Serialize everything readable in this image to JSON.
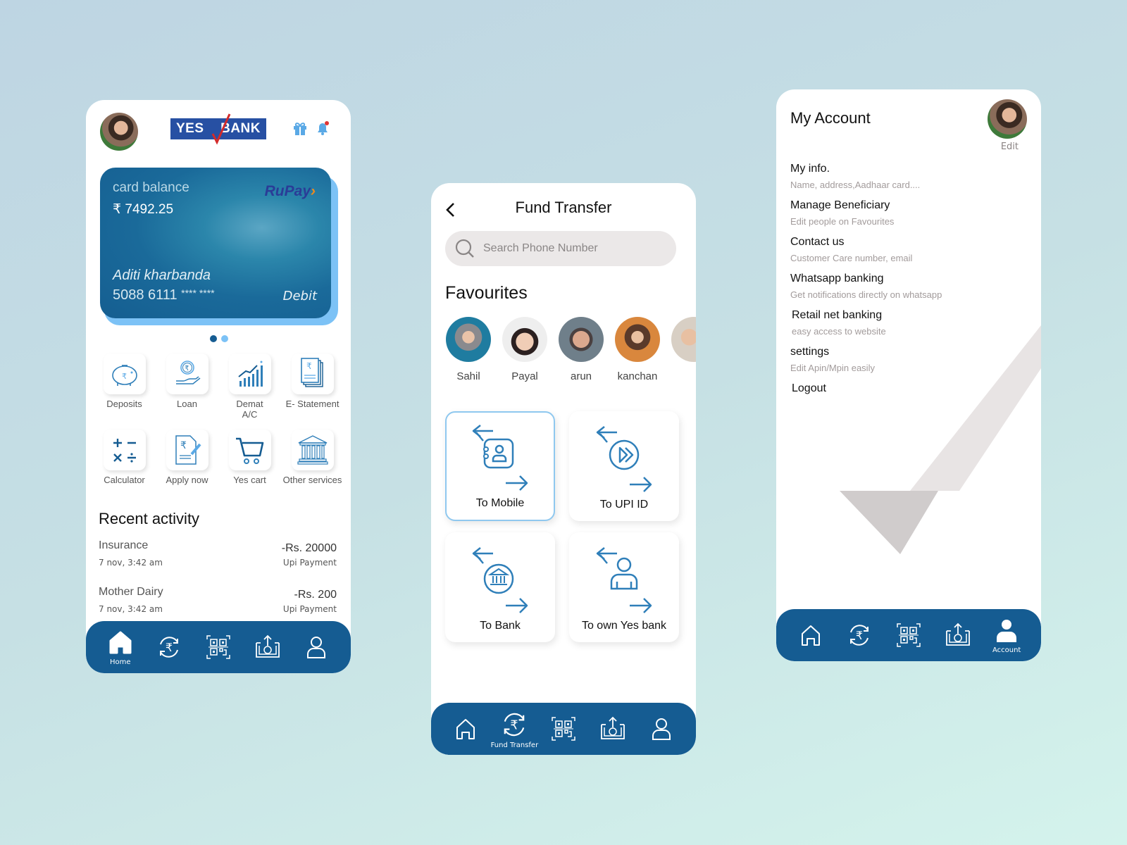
{
  "colors": {
    "brand_blue": "#155c92",
    "accent_light": "#7cc2f6",
    "icon_blue": "#2f7fb9",
    "logo_blue": "#2750a3"
  },
  "home": {
    "logo": {
      "left": "YES",
      "right": "BANK"
    },
    "card": {
      "balance_label": "card balance",
      "currency": "₹",
      "balance": "7492.25",
      "network": "RuPay",
      "holder": "Aditi kharbanda",
      "number_visible": "5088 6111",
      "number_masked": "**** ****",
      "type": "Debit"
    },
    "carousel": {
      "pages": 2,
      "active": 1
    },
    "services": [
      {
        "label": "Deposits",
        "icon": "piggy-bank-icon"
      },
      {
        "label": "Loan",
        "icon": "loan-icon"
      },
      {
        "label": "Demat A/C",
        "icon": "growth-chart-icon"
      },
      {
        "label": "E- Statement",
        "icon": "statement-icon"
      },
      {
        "label": "Calculator",
        "icon": "calculator-icon"
      },
      {
        "label": "Apply now",
        "icon": "apply-form-icon"
      },
      {
        "label": "Yes cart",
        "icon": "cart-icon"
      },
      {
        "label": "Other services",
        "icon": "bank-building-icon"
      }
    ],
    "recent_title": "Recent activity",
    "activity": [
      {
        "title": "Insurance",
        "date": "7 nov, 3:42 am",
        "amount": "-Rs. 20000",
        "method": "Upi Payment"
      },
      {
        "title": "Mother Dairy",
        "date": "7 nov, 3:42 am",
        "amount": "-Rs. 200",
        "method": "Upi Payment"
      }
    ],
    "nav_active_label": "Home"
  },
  "fund": {
    "title": "Fund Transfer",
    "search_placeholder": "Search Phone Number",
    "favourites_title": "Favourites",
    "favourites": [
      {
        "name": "Sahil"
      },
      {
        "name": "Payal"
      },
      {
        "name": "arun"
      },
      {
        "name": "kanchan"
      },
      {
        "name": ""
      }
    ],
    "options": [
      {
        "label": "To Mobile",
        "selected": true
      },
      {
        "label": "To UPI ID",
        "selected": false
      },
      {
        "label": "To Bank",
        "selected": false
      },
      {
        "label": "To own Yes bank",
        "selected": false
      }
    ],
    "nav_active_label": "Fund Transfer"
  },
  "account": {
    "title": "My Account",
    "edit_label": "Edit",
    "menu": [
      {
        "title": "My info.",
        "subtitle": "Name, address,Aadhaar card...."
      },
      {
        "title": "Manage Beneficiary",
        "subtitle": "Edit people on Favourites"
      },
      {
        "title": "Contact us",
        "subtitle": "Customer Care number, email"
      },
      {
        "title": "Whatsapp banking",
        "subtitle": "Get notifications directly on whatsapp"
      },
      {
        "title": "Retail net banking",
        "subtitle": "easy access to website"
      },
      {
        "title": "settings",
        "subtitle": "Edit Apin/Mpin easily"
      },
      {
        "title": "Logout",
        "subtitle": ""
      }
    ],
    "nav_active_label": "Account"
  },
  "nav": [
    "home-icon",
    "fund-transfer-icon",
    "qr-scan-icon",
    "deposit-icon",
    "profile-icon"
  ]
}
